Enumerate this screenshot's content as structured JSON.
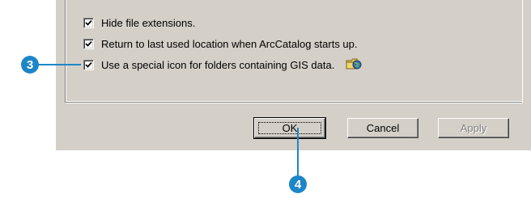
{
  "options": [
    {
      "label": "Hide file extensions.",
      "checked": true
    },
    {
      "label": "Return to last used location when ArcCatalog starts up.",
      "checked": true
    },
    {
      "label": "Use a special icon for folders containing GIS data.",
      "checked": true,
      "icon": "gis-folder-icon"
    }
  ],
  "buttons": {
    "ok": "OK",
    "cancel": "Cancel",
    "apply": "Apply"
  },
  "callouts": {
    "step3": "3",
    "step4": "4"
  },
  "colors": {
    "dialog_bg": "#d4d0c8",
    "callout": "#1e86c7"
  }
}
